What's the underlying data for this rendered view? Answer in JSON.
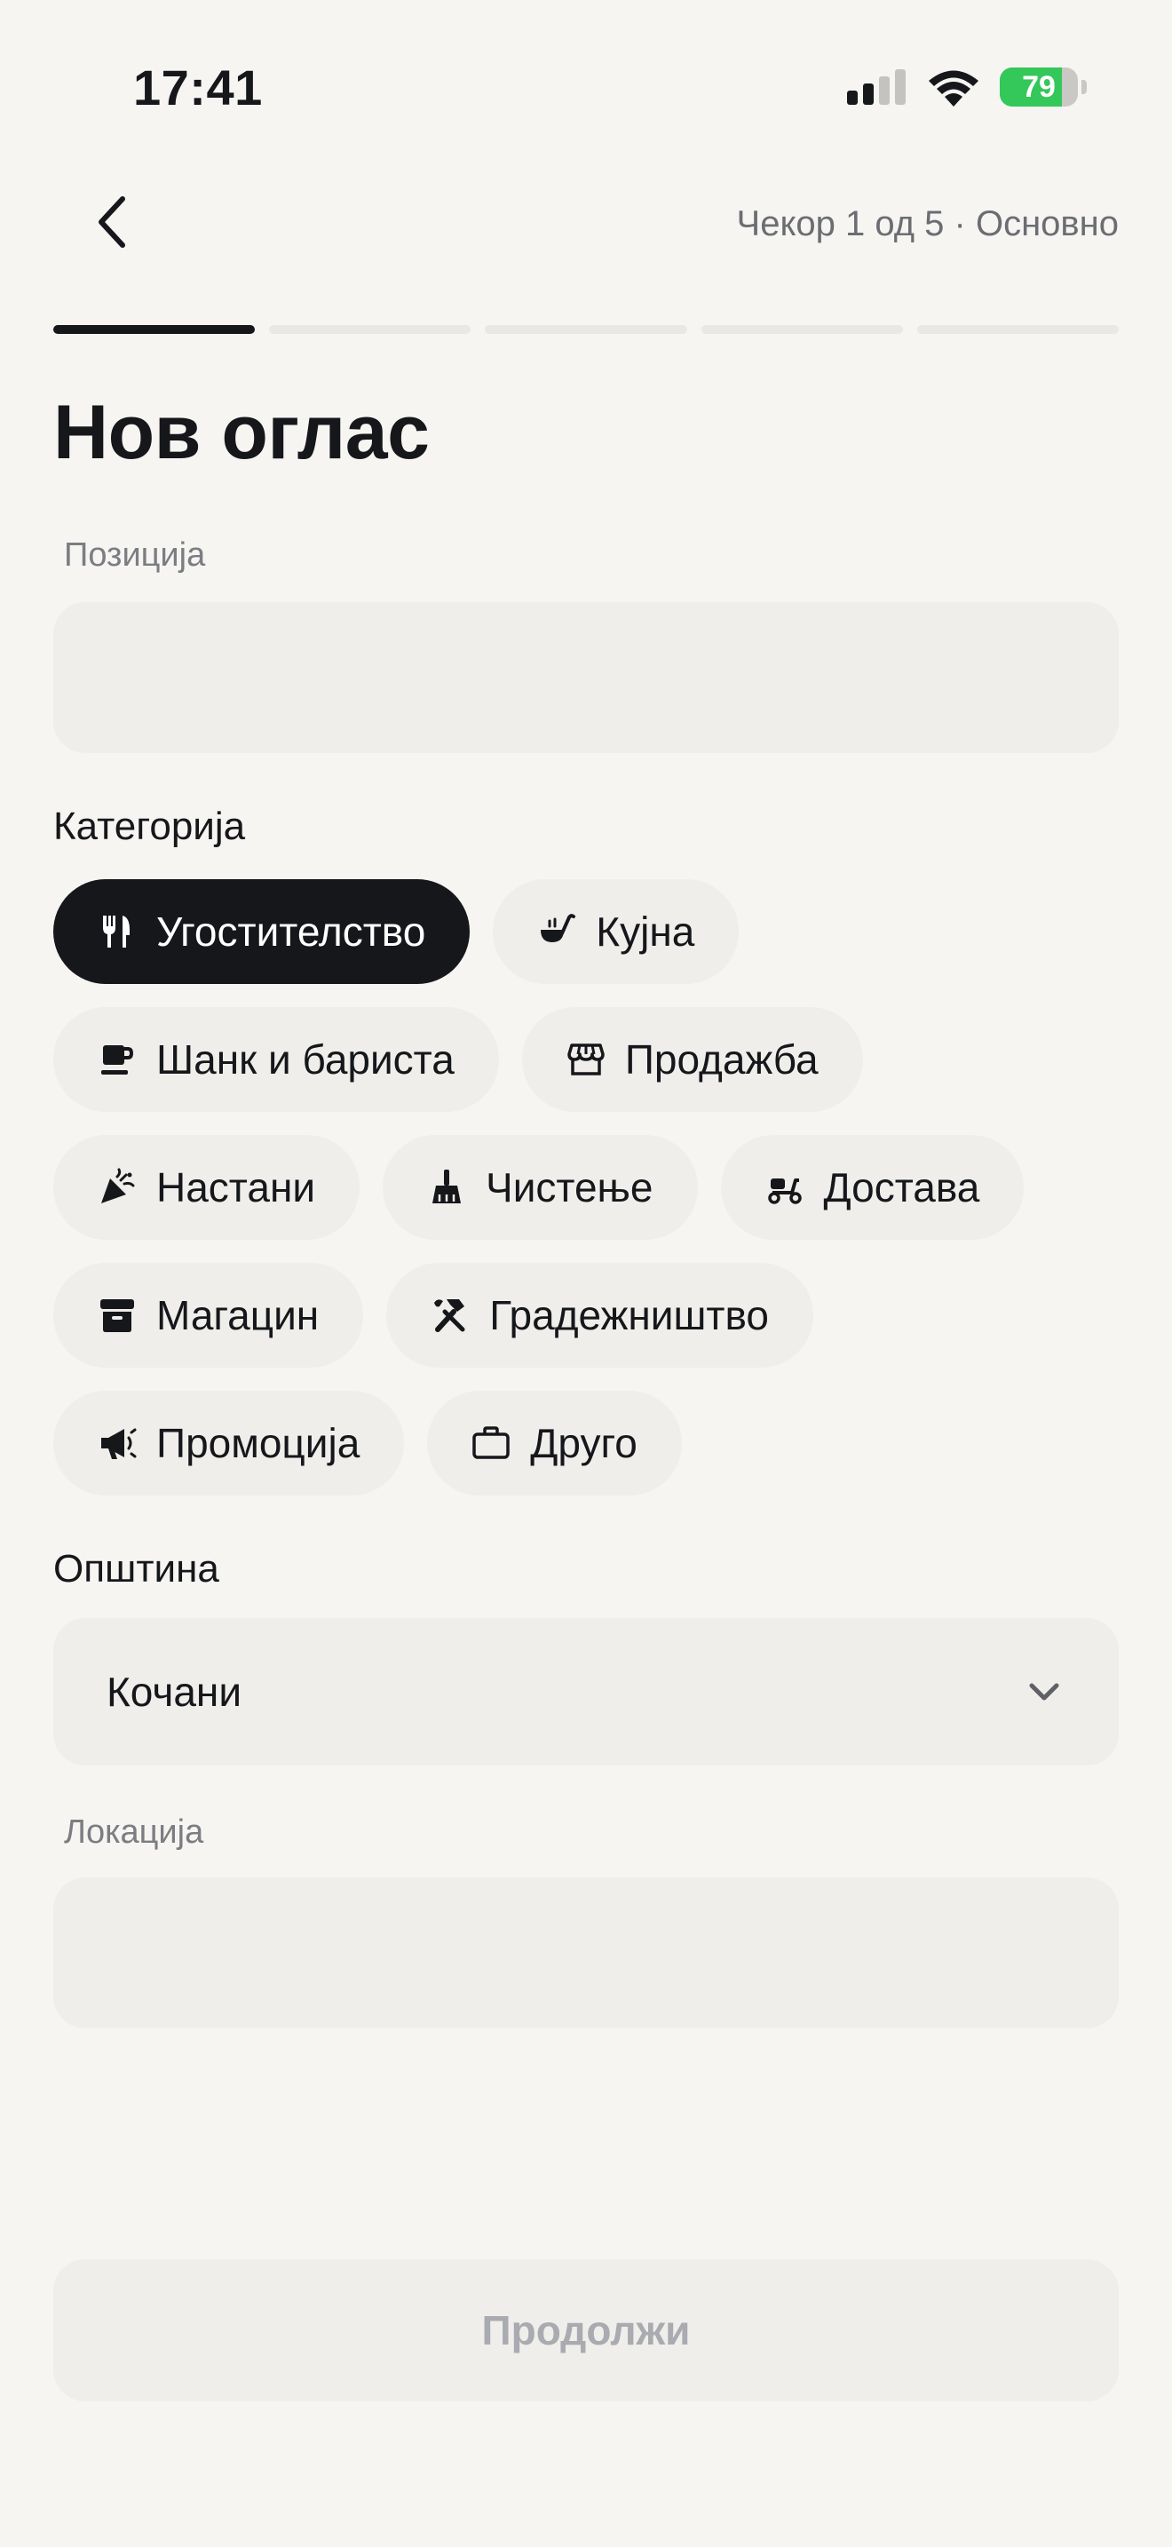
{
  "status_bar": {
    "time": "17:41",
    "battery_percent": "79",
    "battery_level": 0.79,
    "icons": [
      "cellular-signal-icon",
      "wifi-icon",
      "battery-charging-icon"
    ]
  },
  "header": {
    "back_icon": "chevron-left-icon",
    "step_label": "Чекор 1 од 5 · Основно",
    "progress": {
      "current_step": 1,
      "total_steps": 5
    }
  },
  "title": "Нов оглас",
  "position_field": {
    "label": "Позиција",
    "value": "",
    "placeholder": ""
  },
  "category": {
    "label": "Категорија",
    "rows": [
      [
        {
          "label": "Угостителство",
          "icon": "fork-knife-icon",
          "selected": true
        },
        {
          "label": "Кујна",
          "icon": "ladle-icon",
          "selected": false
        }
      ],
      [
        {
          "label": "Шанк и бариста",
          "icon": "coffee-cup-icon",
          "selected": false
        },
        {
          "label": "Продажба",
          "icon": "storefront-icon",
          "selected": false
        }
      ],
      [
        {
          "label": "Настани",
          "icon": "party-popper-icon",
          "selected": false
        },
        {
          "label": "Чистење",
          "icon": "broom-icon",
          "selected": false
        },
        {
          "label": "Достава",
          "icon": "scooter-icon",
          "selected": false
        }
      ],
      [
        {
          "label": "Магацин",
          "icon": "archive-box-icon",
          "selected": false
        },
        {
          "label": "Градежништво",
          "icon": "hammer-wrench-icon",
          "selected": false
        }
      ],
      [
        {
          "label": "Промоција",
          "icon": "megaphone-icon",
          "selected": false
        },
        {
          "label": "Друго",
          "icon": "briefcase-icon",
          "selected": false
        }
      ]
    ]
  },
  "municipality": {
    "label": "Општина",
    "value": "Кочани",
    "icon": "chevron-down-icon"
  },
  "location_field": {
    "label": "Локација",
    "value": "",
    "placeholder": ""
  },
  "continue_button": {
    "label": "Продолжи",
    "enabled": false
  },
  "colors": {
    "background": "#f6f5f2",
    "field_background": "#efeeeb",
    "selected_chip": "#16171b",
    "battery_green": "#34c759",
    "muted_text": "#6b6d72",
    "disabled_text": "#a9abb0"
  }
}
